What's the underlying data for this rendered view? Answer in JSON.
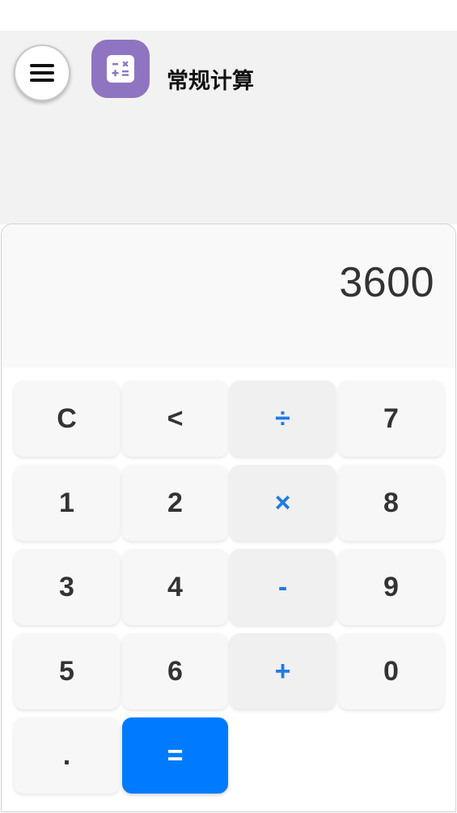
{
  "header": {
    "title": "常规计算",
    "menu_icon": "hamburger-menu-icon",
    "app_icon": "calculator-icon",
    "app_icon_color": "#8f74c2"
  },
  "display": {
    "value": "3600"
  },
  "keys": {
    "clear": "C",
    "backspace": "<",
    "divide": "÷",
    "multiply": "×",
    "subtract": "-",
    "add": "+",
    "seven": "7",
    "eight": "8",
    "nine": "9",
    "zero": "0",
    "one": "1",
    "two": "2",
    "three": "3",
    "four": "4",
    "five": "5",
    "six": "6",
    "decimal": ".",
    "equals": "="
  },
  "colors": {
    "operator_text": "#1e7be6",
    "equals_background": "#007bff",
    "key_background": "#f7f7f7",
    "operator_background": "#f0f0f0"
  }
}
